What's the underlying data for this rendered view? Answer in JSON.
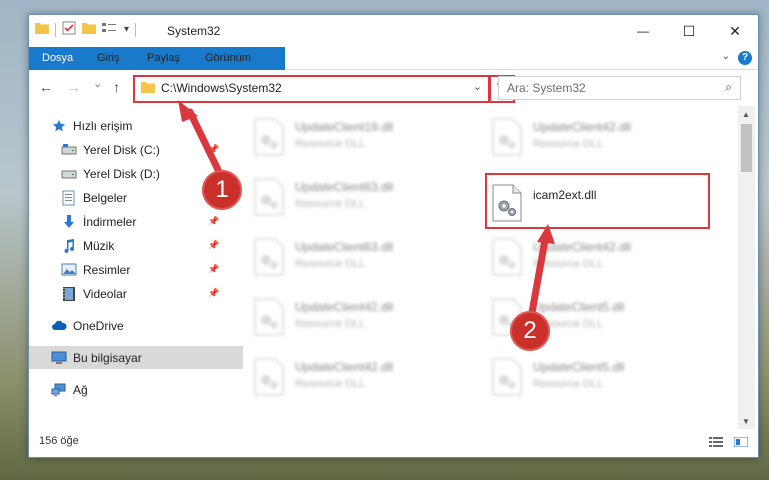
{
  "window": {
    "title": "System32",
    "minimize_glyph": "—",
    "maximize_glyph": "☐",
    "close_glyph": "✕",
    "qa_dropdown_glyph": "▾"
  },
  "ribbon": {
    "tabs": [
      {
        "label": "Dosya"
      },
      {
        "label": "Giriş"
      },
      {
        "label": "Paylaş"
      },
      {
        "label": "Görünüm"
      }
    ],
    "help_glyph": "?",
    "expand_glyph": "⌄"
  },
  "nav": {
    "back_glyph": "←",
    "forward_glyph": "→",
    "recent_glyph": "⌄",
    "up_glyph": "↑",
    "address": "C:\\Windows\\System32",
    "address_dropdown_glyph": "⌄",
    "refresh_glyph": "↻",
    "search_placeholder": "Ara: System32",
    "search_glyph": "⌕"
  },
  "sidebar": {
    "items": [
      {
        "label": "Hızlı erişim",
        "icon": "star-icon"
      },
      {
        "label": "Yerel Disk (C:)",
        "icon": "drive-icon"
      },
      {
        "label": "Yerel Disk (D:)",
        "icon": "drive-icon"
      },
      {
        "label": "Belgeler",
        "icon": "documents-icon"
      },
      {
        "label": "İndirmeler",
        "icon": "download-icon"
      },
      {
        "label": "Müzik",
        "icon": "music-icon"
      },
      {
        "label": "Resimler",
        "icon": "pictures-icon"
      },
      {
        "label": "Videolar",
        "icon": "video-icon"
      },
      {
        "label": "OneDrive",
        "icon": "cloud-icon"
      },
      {
        "label": "Bu bilgisayar",
        "icon": "computer-icon"
      },
      {
        "label": "Ağ",
        "icon": "network-icon"
      }
    ],
    "pin_glyph": "📌"
  },
  "files": [
    {
      "name": "UpdateClient19.dll",
      "desc": "Resource DLL"
    },
    {
      "name": "UpdateClient42.dll",
      "desc": "Resource DLL"
    },
    {
      "name": "UpdateClient63.dll",
      "desc": "Resource DLL"
    },
    {
      "name": "icam2ext.dll",
      "desc": ""
    },
    {
      "name": "UpdateClient63.dll",
      "desc": "Resource DLL"
    },
    {
      "name": "UpdateClient42.dll",
      "desc": "Resource DLL"
    },
    {
      "name": "UpdateClient42.dll",
      "desc": "Resource DLL"
    },
    {
      "name": "UpdateClient5.dll",
      "desc": "Resource DLL"
    },
    {
      "name": "UpdateClient42.dll",
      "desc": "Resource DLL"
    },
    {
      "name": "UpdateClient5.dll",
      "desc": "Resource DLL"
    }
  ],
  "status": {
    "count": "156 öğe"
  },
  "annotations": {
    "marker1": "1",
    "marker2": "2",
    "color": "#d9383e"
  }
}
